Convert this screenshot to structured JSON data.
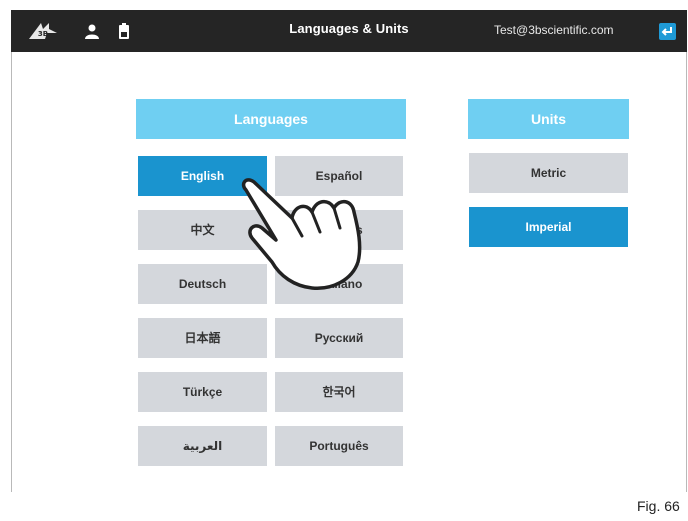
{
  "topbar": {
    "title": "Languages & Units",
    "email": "Test@3bscientific.com",
    "icons": [
      "3b-logo-icon",
      "user-icon",
      "battery-icon",
      "return-icon"
    ]
  },
  "languages": {
    "header": "Languages",
    "selected": "English",
    "items": [
      "English",
      "Español",
      "中文",
      "Français",
      "Deutsch",
      "Italiano",
      "日本語",
      "Русский",
      "Türkçe",
      "한국어",
      "العربية",
      "Português"
    ],
    "visible_labels": [
      "English",
      "Español",
      "中文",
      "Fr…çais",
      "Deutsch",
      "…aliano",
      "日本語",
      "Русский",
      "Türkçe",
      "한국어",
      "العربية",
      "Português"
    ]
  },
  "units": {
    "header": "Units",
    "selected": "Imperial",
    "items": [
      "Metric",
      "Imperial"
    ]
  },
  "caption": "Fig. 66",
  "colors": {
    "topbar": "#252525",
    "header": "#6fcff2",
    "selected": "#1a94cf",
    "button": "#d4d7dc"
  }
}
